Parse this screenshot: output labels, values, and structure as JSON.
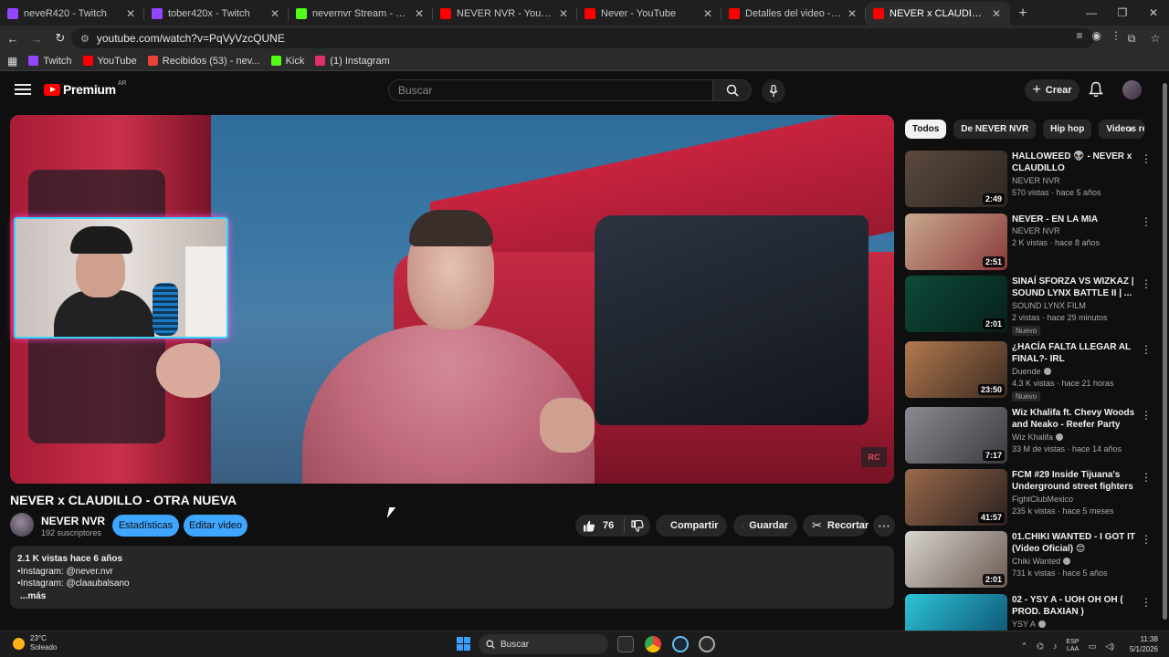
{
  "browser": {
    "tabs": [
      {
        "title": "neveR420 - Twitch",
        "favicon_color": "#9146ff",
        "active": false
      },
      {
        "title": "tober420x - Twitch",
        "favicon_color": "#9146ff",
        "active": false
      },
      {
        "title": "nevernvr Stream - Watch Live o",
        "favicon_color": "#53fc18",
        "active": false
      },
      {
        "title": "NEVER NVR - YouTube",
        "favicon_color": "#ff0000",
        "active": false
      },
      {
        "title": "Never - YouTube",
        "favicon_color": "#ff0000",
        "active": false
      },
      {
        "title": "Detalles del video - YouTube St",
        "favicon_color": "#ff0000",
        "active": false
      },
      {
        "title": "NEVER x CLAUDILLO - OTRA NU",
        "favicon_color": "#ff0000",
        "active": true
      }
    ],
    "url": "youtube.com/watch?v=PqVyVzcQUNE",
    "bookmarks": [
      {
        "label": "Twitch",
        "color": "#9146ff"
      },
      {
        "label": "YouTube",
        "color": "#ff0000"
      },
      {
        "label": "Recibidos (53) - nev...",
        "color": "#ea4335"
      },
      {
        "label": "Kick",
        "color": "#53fc18"
      },
      {
        "label": "(1) Instagram",
        "color": "#e1306c"
      }
    ]
  },
  "header": {
    "logo": "Premium",
    "region": "AR",
    "search_placeholder": "Buscar",
    "create_label": "Crear"
  },
  "video": {
    "title": "NEVER x CLAUDILLO - OTRA NUEVA",
    "watermark": "RC",
    "channel": "NEVER NVR",
    "subscribers": "192 suscriptores",
    "stats_label": "Estadísticas",
    "edit_label": "Editar video",
    "likes": "76",
    "share_label": "Compartir",
    "save_label": "Guardar",
    "clip_label": "Recortar",
    "desc_meta": "2.1 K vistas  hace 6 años",
    "desc_line1": "•Instagram: @never.nvr",
    "desc_line2": "•Instagram: @claaubalsano",
    "desc_more": "...más"
  },
  "chips": [
    "Todos",
    "De NEVER NVR",
    "Hip hop",
    "Videos re"
  ],
  "recommendations": [
    {
      "title": "HALLOWEED 👽 - NEVER x CLAUDILLO",
      "channel": "NEVER NVR",
      "views": "570 vistas · hace 5 años",
      "duration": "2:49",
      "verified": false,
      "new": "",
      "thumb_colors": [
        "#5b4a3e",
        "#2d2620"
      ]
    },
    {
      "title": "NEVER - EN LA MIA",
      "channel": "NEVER NVR",
      "views": "2 K vistas · hace 8 años",
      "duration": "2:51",
      "verified": false,
      "new": "",
      "thumb_colors": [
        "#c9a98f",
        "#8a3a3a"
      ]
    },
    {
      "title": "SINAÍ SFORZA VS WIZKAZ | SOUND LYNX BATTLE II | ...",
      "channel": "SOUND LYNX FILM",
      "views": "2 vistas · hace 29 minutos",
      "duration": "2:01",
      "verified": false,
      "new": "Nuevo",
      "thumb_colors": [
        "#0e4a3a",
        "#06201a"
      ]
    },
    {
      "title": "¿HACÍA FALTA LLEGAR AL FINAL?- IRL",
      "channel": "Duende",
      "views": "4.3 K vistas · hace 21 horas",
      "duration": "23:50",
      "verified": true,
      "new": "Nuevo",
      "thumb_colors": [
        "#b37a50",
        "#3a2a20"
      ]
    },
    {
      "title": "Wiz Khalifa ft. Chevy Woods and Neako - Reefer Party",
      "channel": "Wiz Khalifa",
      "views": "33 M de vistas · hace 14 años",
      "duration": "7:17",
      "verified": true,
      "new": "",
      "thumb_colors": [
        "#8a8a90",
        "#3a3a40"
      ]
    },
    {
      "title": "FCM #29  Inside Tijuana's Underground street fighters K...",
      "channel": "FightClubMexico",
      "views": "235 k vistas · hace 5 meses",
      "duration": "41:57",
      "verified": false,
      "new": "",
      "thumb_colors": [
        "#9a6a4a",
        "#2a2020"
      ]
    },
    {
      "title": "01.CHIKI WANTED - I GOT IT (Video Oficial) 😊",
      "channel": "Chiki Wanted",
      "views": "731 k vistas · hace 5 años",
      "duration": "2:01",
      "verified": true,
      "new": "",
      "thumb_colors": [
        "#d8d4d0",
        "#6a5a50"
      ]
    },
    {
      "title": "02 - YSY A - UOH OH OH ( PROD. BAXIAN )",
      "channel": "YSY A",
      "views": "",
      "duration": "",
      "verified": true,
      "new": "",
      "thumb_colors": [
        "#2ec4d8",
        "#0a4a6a"
      ]
    }
  ],
  "taskbar": {
    "temp": "23°C",
    "weather": "Soleado",
    "search": "Buscar",
    "lang1": "ESP",
    "lang2": "LAA",
    "time": "11:38",
    "date": "5/1/2026"
  }
}
